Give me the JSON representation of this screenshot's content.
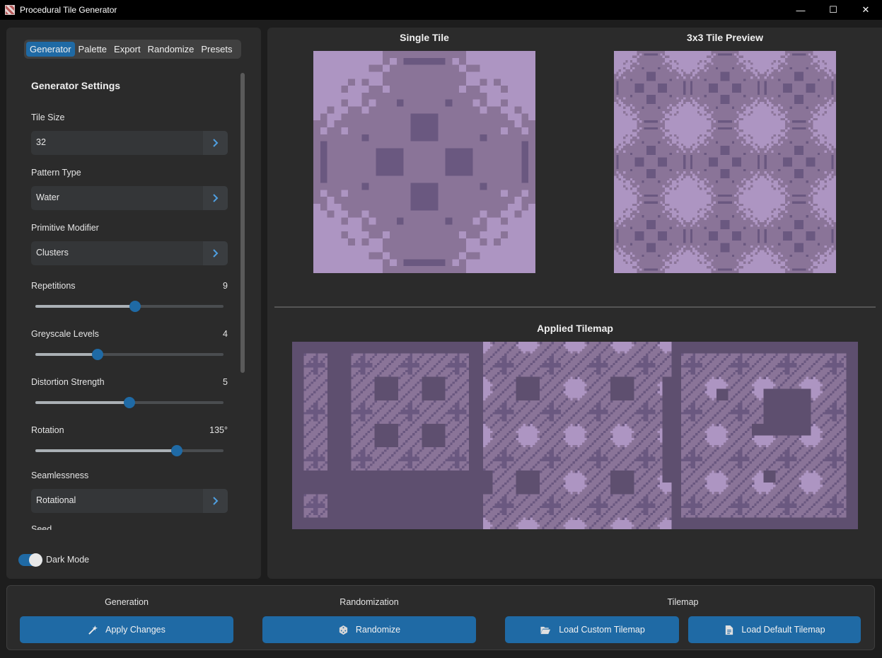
{
  "window": {
    "title": "Procedural Tile Generator",
    "controls": [
      "—",
      "☐",
      "✕"
    ]
  },
  "tabs": [
    "Generator",
    "Palette",
    "Export",
    "Randomize",
    "Presets"
  ],
  "active_tab": "Generator",
  "settings": {
    "title": "Generator Settings",
    "tile_size": {
      "label": "Tile Size",
      "value": "32"
    },
    "pattern_type": {
      "label": "Pattern Type",
      "value": "Water"
    },
    "primitive_modifier": {
      "label": "Primitive Modifier",
      "value": "Clusters"
    },
    "repetitions": {
      "label": "Repetitions",
      "value": "9",
      "fraction": 0.53
    },
    "greyscale_levels": {
      "label": "Greyscale Levels",
      "value": "4",
      "fraction": 0.33
    },
    "distortion_strength": {
      "label": "Distortion Strength",
      "value": "5",
      "fraction": 0.5
    },
    "rotation": {
      "label": "Rotation",
      "value": "135°",
      "fraction": 0.75
    },
    "seamlessness": {
      "label": "Seamlessness",
      "value": "Rotational"
    },
    "seed": {
      "label": "Seed"
    }
  },
  "dark_mode": {
    "label": "Dark Mode",
    "on": true
  },
  "previews": {
    "single_tile": "Single Tile",
    "preview_3x3": "3x3 Tile Preview",
    "applied_tilemap": "Applied Tilemap"
  },
  "bottom": {
    "generation": {
      "label": "Generation",
      "button": "Apply Changes"
    },
    "randomization": {
      "label": "Randomization",
      "button": "Randomize"
    },
    "tilemap": {
      "label": "Tilemap",
      "load_custom": "Load Custom Tilemap",
      "load_default": "Load Default Tilemap"
    }
  },
  "colors": {
    "accent": "#1f6aa5",
    "tile_light": "#ad95c2",
    "tile_mid": "#8a7498",
    "tile_dark": "#6a5880",
    "tile_darkest": "#5e4f6f"
  }
}
